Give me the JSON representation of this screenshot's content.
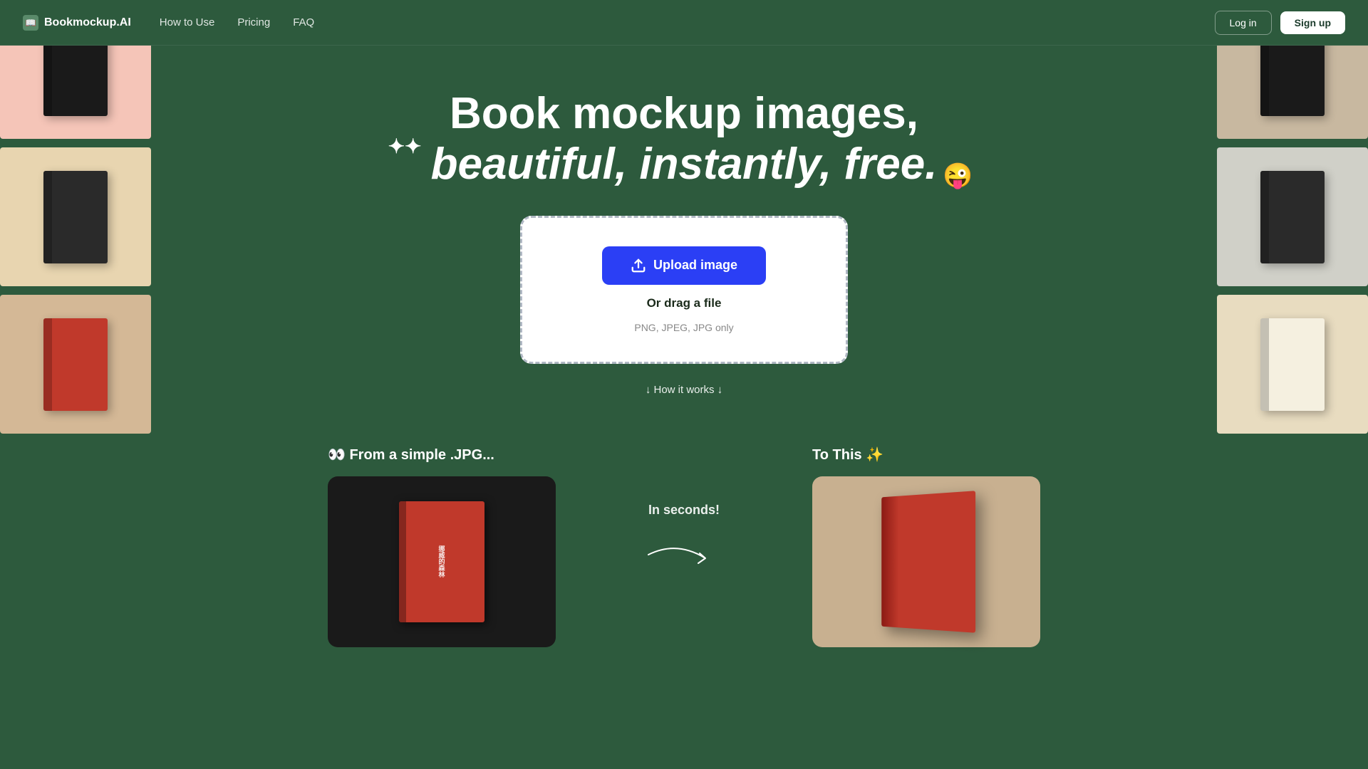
{
  "nav": {
    "logo_text": "Bookmockup.AI",
    "logo_icon": "📖",
    "links": [
      {
        "label": "How to Use",
        "id": "how-to-use"
      },
      {
        "label": "Pricing",
        "id": "pricing"
      },
      {
        "label": "FAQ",
        "id": "faq"
      }
    ],
    "login_label": "Log in",
    "signup_label": "Sign up"
  },
  "hero": {
    "title_line1": "Book mockup images,",
    "title_line2": "beautiful, instantly, free.",
    "sparkle": "✦✦",
    "emoji": "😜",
    "upload_button": "Upload image",
    "drag_text": "Or drag a file",
    "file_types": "PNG, JPEG, JPG only",
    "how_it_works": "↓ How it works ↓"
  },
  "bottom": {
    "from_label": "👀 From a simple .JPG...",
    "to_label": "To This ✨",
    "in_seconds": "In seconds!"
  }
}
